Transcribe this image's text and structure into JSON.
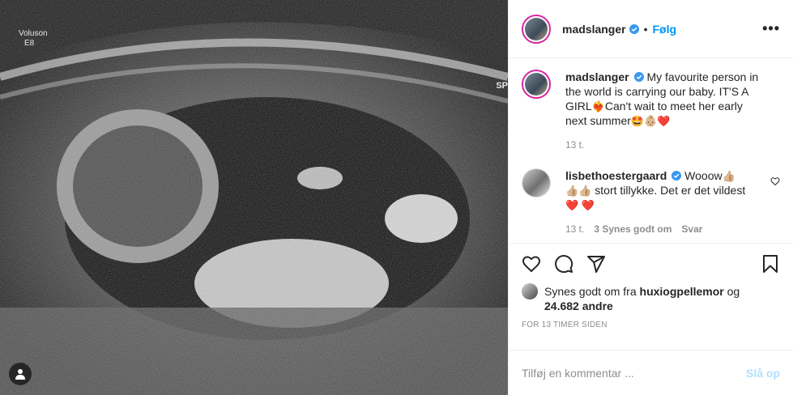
{
  "media": {
    "scan_labels": {
      "top_left_line1": "Voluson",
      "top_left_line2": "E8",
      "top_right": "SP"
    }
  },
  "post": {
    "username": "madslanger",
    "follow_label": "Følg",
    "dot": "•",
    "more": "•••"
  },
  "caption": {
    "username": "madslanger",
    "text": "My favourite person in the world is carrying our baby. IT'S A GIRL",
    "emoji1": "❤️‍🔥",
    "text2": "Can't wait to meet her early next summer",
    "emojis_end": "🤩👶🏼❤️",
    "time": "13 t."
  },
  "comment": {
    "username": "lisbethoestergaard",
    "text1": "Wooow",
    "emoji1": "👍🏼",
    "emoji2": "👍🏼👍🏼",
    "text2": "stort tillykke. Det er det vildest",
    "emojis_end": "❤️ ❤️",
    "time": "13 t.",
    "likes": "3 Synes godt om",
    "reply": "Svar"
  },
  "likes": {
    "prefix": "Synes godt om fra",
    "user": "huxiogpellemor",
    "mid": "og",
    "count": "24.682 andre"
  },
  "timestamp": "FOR 13 TIMER SIDEN",
  "add_comment": {
    "placeholder": "Tilføj en kommentar ...",
    "post_label": "Slå op"
  },
  "colors": {
    "accent": "#0095f6",
    "post_disabled": "#b2dffc",
    "heart": "#e0245e"
  }
}
